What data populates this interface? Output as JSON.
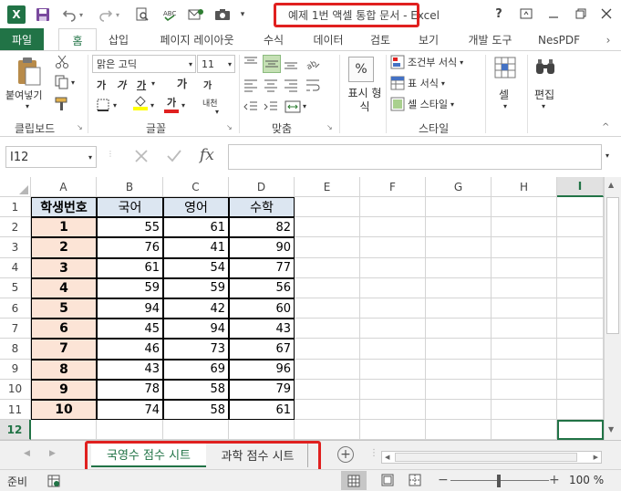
{
  "window": {
    "title": "예제 1번 액셀 통합 문서 - Excel",
    "controls": [
      "?",
      "restore",
      "minimize",
      "maximize",
      "close"
    ]
  },
  "quick_access": {
    "excel_icon": "X",
    "save": "save-icon",
    "undo": "undo-icon",
    "redo": "redo-icon",
    "preview": "print-preview-icon",
    "mail": "mail-icon",
    "camera": "camera-icon"
  },
  "tabs": {
    "file": "파일",
    "items": [
      "홈",
      "삽입",
      "페이지 레이아웃",
      "수식",
      "데이터",
      "검토",
      "보기",
      "개발 도구",
      "NesPDF"
    ]
  },
  "ribbon": {
    "clipboard": {
      "paste": "붙여넣기",
      "label": "클립보드"
    },
    "font": {
      "name": "맑은 고딕",
      "size": "11",
      "bold": "가",
      "italic": "가",
      "underline": "가",
      "grow": "가",
      "shrink": "가",
      "fill_color": "가",
      "font_color": "가",
      "phonetic": "내천",
      "label": "글꼴"
    },
    "alignment": {
      "label": "맞춤"
    },
    "number": {
      "percent": "%",
      "display_format": "표시 형식",
      "label": ""
    },
    "styles": {
      "conditional": "조건부 서식",
      "table": "표 서식",
      "cell": "셀 스타일",
      "label": "스타일"
    },
    "cells": {
      "label": "셀"
    },
    "editing": {
      "label": "편집"
    }
  },
  "formula_bar": {
    "name_box": "I12",
    "fx": "fx",
    "formula": ""
  },
  "grid": {
    "columns": [
      "A",
      "B",
      "C",
      "D",
      "E",
      "F",
      "G",
      "H",
      "I"
    ],
    "rows": [
      "1",
      "2",
      "3",
      "4",
      "5",
      "6",
      "7",
      "8",
      "9",
      "10",
      "11",
      "12"
    ],
    "header": [
      "학생번호",
      "국어",
      "영어",
      "수학"
    ],
    "data": [
      [
        "1",
        "55",
        "61",
        "82"
      ],
      [
        "2",
        "76",
        "41",
        "90"
      ],
      [
        "3",
        "61",
        "54",
        "77"
      ],
      [
        "4",
        "59",
        "59",
        "56"
      ],
      [
        "5",
        "94",
        "42",
        "60"
      ],
      [
        "6",
        "45",
        "94",
        "43"
      ],
      [
        "7",
        "46",
        "73",
        "67"
      ],
      [
        "8",
        "43",
        "69",
        "96"
      ],
      [
        "9",
        "78",
        "58",
        "79"
      ],
      [
        "10",
        "74",
        "58",
        "61"
      ]
    ],
    "colors": {
      "header_fill": "#dce6f1",
      "id_fill": "#fce4d6",
      "highlight": "#e0201f",
      "accent": "#217346"
    }
  },
  "sheets": {
    "tabs": [
      "국영수 점수 시트",
      "과학 점수 시트"
    ],
    "active": 0,
    "add": "+"
  },
  "status": {
    "ready": "준비",
    "zoom": "100 %"
  }
}
